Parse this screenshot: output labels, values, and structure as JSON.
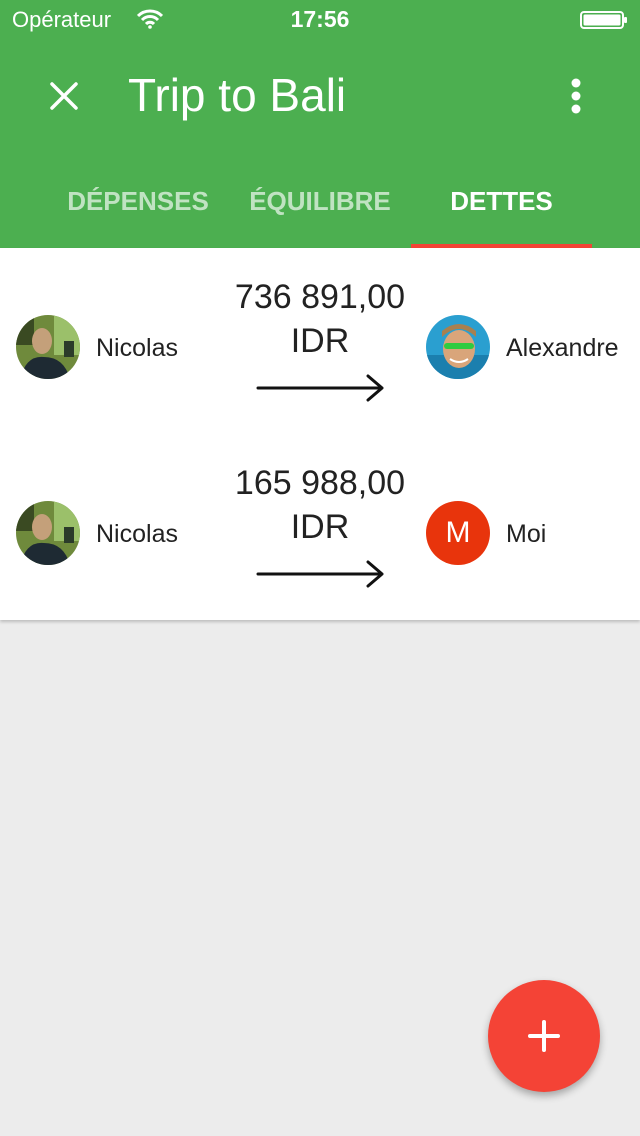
{
  "status_bar": {
    "carrier": "Opérateur",
    "time": "17:56",
    "wifi_icon": "wifi-icon",
    "battery_icon": "battery-icon"
  },
  "app_bar": {
    "title": "Trip to Bali",
    "close_icon": "close-icon",
    "more_icon": "more-vert-icon"
  },
  "tabs": [
    {
      "label": "DÉPENSES",
      "active": false
    },
    {
      "label": "ÉQUILIBRE",
      "active": false
    },
    {
      "label": "DETTES",
      "active": true
    }
  ],
  "debts": [
    {
      "from": "Nicolas",
      "amount": "736 891,00",
      "currency": "IDR",
      "to": "Alexandre",
      "to_avatar_letter": ""
    },
    {
      "from": "Nicolas",
      "amount": "165 988,00",
      "currency": "IDR",
      "to": "Moi",
      "to_avatar_letter": "M"
    }
  ],
  "fab": {
    "icon": "add-icon"
  },
  "colors": {
    "primary": "#4caf50",
    "accent": "#f44336",
    "avatar_m": "#e8340c",
    "background": "#ececec"
  }
}
